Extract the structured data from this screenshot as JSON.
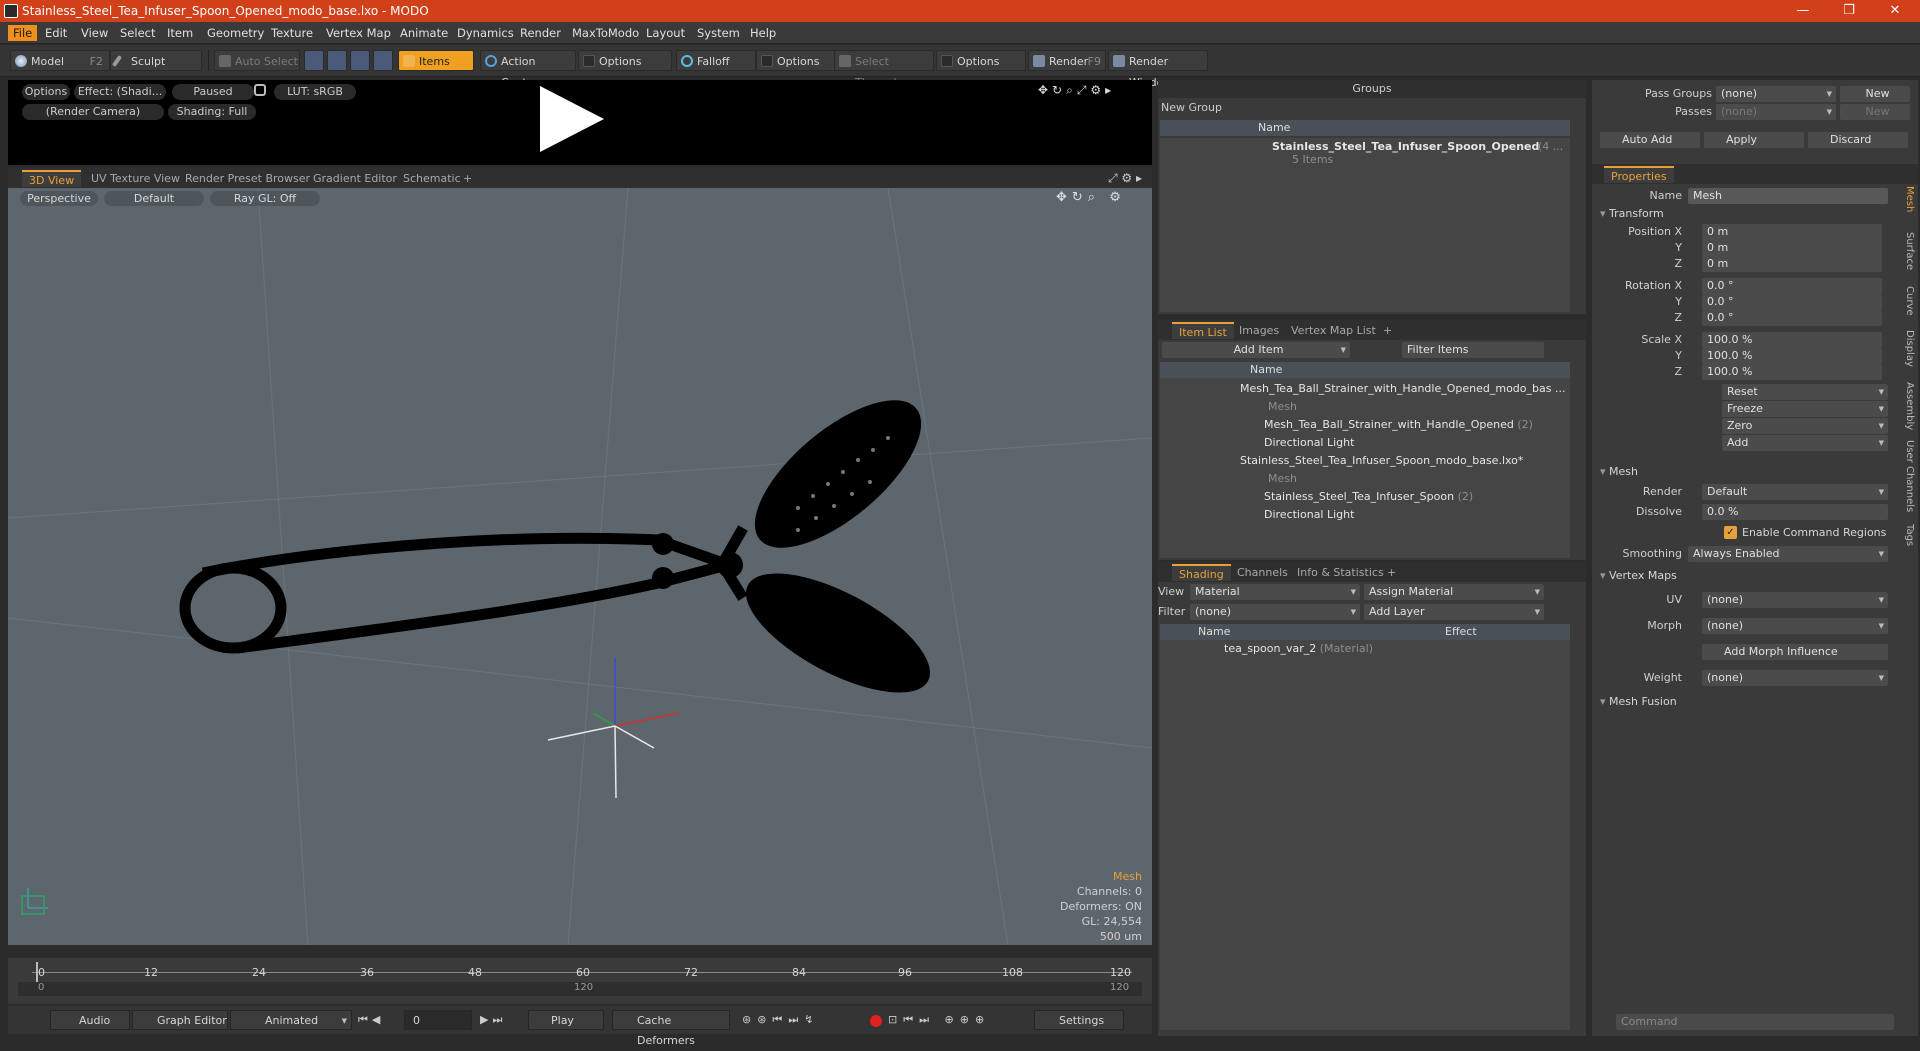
{
  "window": {
    "title": "Stainless_Steel_Tea_Infuser_Spoon_Opened_modo_base.lxo - MODO",
    "minimize": "—",
    "maximize": "❐",
    "close": "✕"
  },
  "menu": [
    "File",
    "Edit",
    "View",
    "Select",
    "Item",
    "Geometry",
    "Texture",
    "Vertex Map",
    "Animate",
    "Dynamics",
    "Render",
    "MaxToModo",
    "Layout",
    "System",
    "Help"
  ],
  "toolbar": {
    "model": "Model",
    "model_key": "F2",
    "sculpt": "Sculpt",
    "auto_select": "Auto Select",
    "items": "Items",
    "action_center": "Action Center",
    "options1": "Options",
    "falloff": "Falloff",
    "options2": "Options",
    "select_through": "Select Through",
    "options3": "Options",
    "render": "Render",
    "render_key": "F9",
    "render_window": "Render Window"
  },
  "preview": {
    "options": "Options",
    "effect": "Effect: (Shadi...",
    "paused": "Paused",
    "lut": "LUT: sRGB",
    "camera": "(Render Camera)",
    "shading": "Shading: Full"
  },
  "view_tabs": [
    "3D View",
    "UV Texture View",
    "Render Preset Browser",
    "Gradient Editor",
    "Schematic",
    "+"
  ],
  "viewport": {
    "projection": "Perspective",
    "style": "Default",
    "raygl": "Ray GL: Off",
    "info": {
      "type": "Mesh",
      "channels": "Channels: 0",
      "deformers": "Deformers: ON",
      "gl": "GL: 24,554",
      "scale": "500 um"
    }
  },
  "timeline": {
    "ticks": [
      "0",
      "12",
      "24",
      "36",
      "48",
      "60",
      "72",
      "84",
      "96",
      "108",
      "120"
    ],
    "sub_start": "0",
    "sub_mid": "120",
    "sub_end": "120"
  },
  "transport": {
    "audio": "Audio",
    "graph_editor": "Graph Editor",
    "animated": "Animated",
    "frame": "0",
    "play": "Play",
    "cache_deformers": "Cache Deformers",
    "settings": "Settings"
  },
  "groups": {
    "title": "Groups",
    "new_group": "New Group",
    "col_name": "Name",
    "item_name": "Stainless_Steel_Tea_Infuser_Spoon_Opened",
    "item_count": "(4 ...",
    "item_sub": "5 Items"
  },
  "itemlist": {
    "tabs": [
      "Item List",
      "Images",
      "Vertex Map List",
      "+"
    ],
    "add_item": "Add Item",
    "filter": "Filter Items",
    "col_name": "Name",
    "rows": [
      {
        "label": "Mesh_Tea_Ball_Strainer_with_Handle_Opened_modo_bas ...",
        "dim": false
      },
      {
        "label": "Mesh",
        "dim": true
      },
      {
        "label": "Mesh_Tea_Ball_Strainer_with_Handle_Opened",
        "suffix": "(2)",
        "dim": false
      },
      {
        "label": "Directional Light",
        "dim": false
      },
      {
        "label": "Stainless_Steel_Tea_Infuser_Spoon_modo_base.lxo*",
        "dim": false
      },
      {
        "label": "Mesh",
        "dim": true
      },
      {
        "label": "Stainless_Steel_Tea_Infuser_Spoon",
        "suffix": "(2)",
        "dim": false
      },
      {
        "label": "Directional Light",
        "dim": false
      }
    ]
  },
  "shading": {
    "tabs": [
      "Shading",
      "Channels",
      "Info & Statistics",
      "+"
    ],
    "view_label": "View",
    "view_value": "Material",
    "assign": "Assign Material",
    "filter_label": "Filter",
    "filter_value": "(none)",
    "add_layer": "Add Layer",
    "col_name": "Name",
    "col_effect": "Effect",
    "material": "tea_spoon_var_2",
    "material_type": "(Material)"
  },
  "passes": {
    "pass_groups": "Pass Groups",
    "pass_value": "(none)",
    "new": "New",
    "passes": "Passes",
    "passes_value": "(none)",
    "new2": "New",
    "auto_add": "Auto Add",
    "apply": "Apply",
    "discard": "Discard"
  },
  "properties": {
    "tab": "Properties",
    "name_label": "Name",
    "name_value": "Mesh",
    "transform": "Transform",
    "pos_label": "Position X",
    "pos": [
      "0 m",
      "0 m",
      "0 m"
    ],
    "rot_label": "Rotation X",
    "rot": [
      "0.0 °",
      "0.0 °",
      "0.0 °"
    ],
    "scale_label": "Scale X",
    "scale": [
      "100.0 %",
      "100.0 %",
      "100.0 %"
    ],
    "y": "Y",
    "z": "Z",
    "actions": [
      "Reset",
      "Freeze",
      "Zero",
      "Add"
    ],
    "mesh": "Mesh",
    "render_label": "Render",
    "render_value": "Default",
    "dissolve_label": "Dissolve",
    "dissolve_value": "0.0 %",
    "enable_cmd": "Enable Command Regions",
    "smoothing_label": "Smoothing",
    "smoothing_value": "Always Enabled",
    "vertex_maps": "Vertex Maps",
    "uv_label": "UV",
    "uv_value": "(none)",
    "morph_label": "Morph",
    "morph_value": "(none)",
    "add_morph": "Add Morph Influence",
    "weight_label": "Weight",
    "weight_value": "(none)",
    "mesh_fusion": "Mesh Fusion",
    "side_tabs": [
      "Mesh",
      "Surface",
      "Curve",
      "Display",
      "Assembly",
      "User Channels",
      "Tags"
    ]
  },
  "command": {
    "placeholder": "Command"
  }
}
